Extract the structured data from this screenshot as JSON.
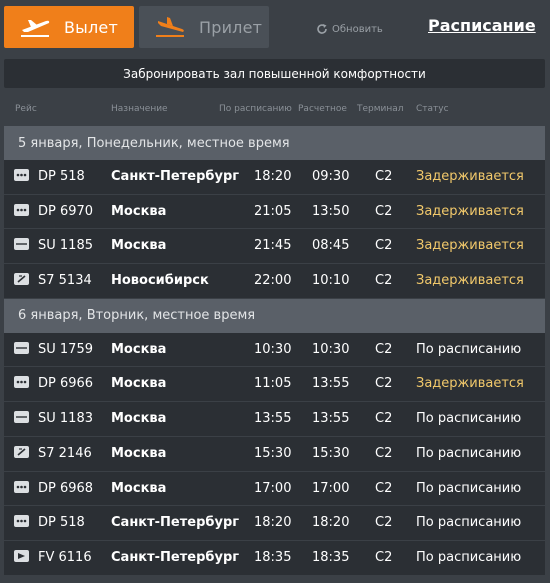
{
  "tabs": {
    "departure": {
      "label": "Вылет",
      "icon": "plane-takeoff-icon"
    },
    "arrival": {
      "label": "Прилет",
      "icon": "plane-landing-icon"
    }
  },
  "refresh_label": "Обновить",
  "schedule_link": "Расписание",
  "lounge_button": "Забронировать зал повышенной комфортности",
  "columns": {
    "flight": "Рейс",
    "destination": "Назначение",
    "scheduled": "По расписанию",
    "estimated": "Расчетное",
    "terminal": "Терминал",
    "status": "Статус"
  },
  "days": [
    {
      "label": "5 января, Понедельник, местное время",
      "flights": [
        {
          "number": "DP 518",
          "destination": "Санкт-Петербург",
          "scheduled": "18:20",
          "estimated": "09:30",
          "terminal": "C2",
          "status": "Задерживается",
          "delayed": true,
          "airline_icon": "pobeda-logo-icon"
        },
        {
          "number": "DP 6970",
          "destination": "Москва",
          "scheduled": "21:05",
          "estimated": "13:50",
          "terminal": "C2",
          "status": "Задерживается",
          "delayed": true,
          "airline_icon": "pobeda-logo-icon"
        },
        {
          "number": "SU 1185",
          "destination": "Москва",
          "scheduled": "21:45",
          "estimated": "08:45",
          "terminal": "C2",
          "status": "Задерживается",
          "delayed": true,
          "airline_icon": "aeroflot-logo-icon"
        },
        {
          "number": "S7 5134",
          "destination": "Новосибирск",
          "scheduled": "22:00",
          "estimated": "10:10",
          "terminal": "C2",
          "status": "Задерживается",
          "delayed": true,
          "airline_icon": "s7-logo-icon"
        }
      ]
    },
    {
      "label": "6 января, Вторник, местное время",
      "flights": [
        {
          "number": "SU 1759",
          "destination": "Москва",
          "scheduled": "10:30",
          "estimated": "10:30",
          "terminal": "C2",
          "status": "По расписанию",
          "delayed": false,
          "airline_icon": "aeroflot-logo-icon"
        },
        {
          "number": "DP 6966",
          "destination": "Москва",
          "scheduled": "11:05",
          "estimated": "13:55",
          "terminal": "C2",
          "status": "Задерживается",
          "delayed": true,
          "airline_icon": "pobeda-logo-icon"
        },
        {
          "number": "SU 1183",
          "destination": "Москва",
          "scheduled": "13:55",
          "estimated": "13:55",
          "terminal": "C2",
          "status": "По расписанию",
          "delayed": false,
          "airline_icon": "aeroflot-logo-icon"
        },
        {
          "number": "S7 2146",
          "destination": "Москва",
          "scheduled": "15:30",
          "estimated": "15:30",
          "terminal": "C2",
          "status": "По расписанию",
          "delayed": false,
          "airline_icon": "s7-logo-icon"
        },
        {
          "number": "DP 6968",
          "destination": "Москва",
          "scheduled": "17:00",
          "estimated": "17:00",
          "terminal": "C2",
          "status": "По расписанию",
          "delayed": false,
          "airline_icon": "pobeda-logo-icon"
        },
        {
          "number": "DP 518",
          "destination": "Санкт-Петербург",
          "scheduled": "18:20",
          "estimated": "18:20",
          "terminal": "C2",
          "status": "По расписанию",
          "delayed": false,
          "airline_icon": "pobeda-logo-icon"
        },
        {
          "number": "FV 6116",
          "destination": "Санкт-Петербург",
          "scheduled": "18:35",
          "estimated": "18:35",
          "terminal": "C2",
          "status": "По расписанию",
          "delayed": false,
          "airline_icon": "rossiya-logo-icon"
        }
      ]
    }
  ],
  "colors": {
    "accent": "#f07f1a",
    "background": "#3b4046",
    "row": "#2b2f34",
    "day_header": "#5a6068",
    "delayed": "#f2c96b"
  }
}
